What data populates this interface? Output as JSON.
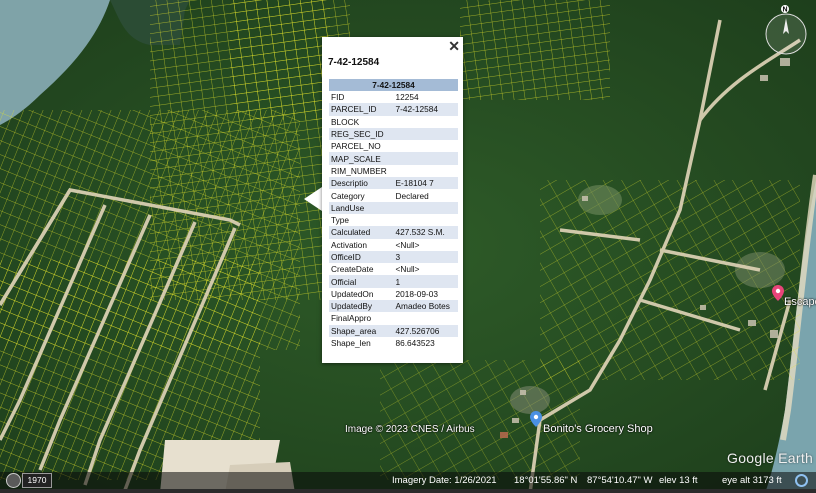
{
  "popup": {
    "title": "7-42-12584",
    "table_header": "7-42-12584",
    "rows": [
      {
        "key": "FID",
        "value": "12254"
      },
      {
        "key": "PARCEL_ID",
        "value": "7-42-12584"
      },
      {
        "key": "BLOCK",
        "value": ""
      },
      {
        "key": "REG_SEC_ID",
        "value": ""
      },
      {
        "key": "PARCEL_NO",
        "value": ""
      },
      {
        "key": "MAP_SCALE",
        "value": ""
      },
      {
        "key": "RIM_NUMBER",
        "value": ""
      },
      {
        "key": "Descriptio",
        "value": "E-18104 7"
      },
      {
        "key": "Category",
        "value": "Declared"
      },
      {
        "key": "LandUse",
        "value": ""
      },
      {
        "key": "Type",
        "value": ""
      },
      {
        "key": "Calculated",
        "value": "427.532 S.M."
      },
      {
        "key": "Activation",
        "value": "<Null>"
      },
      {
        "key": "OfficeID",
        "value": "3"
      },
      {
        "key": "CreateDate",
        "value": "<Null>"
      },
      {
        "key": "Official",
        "value": "1"
      },
      {
        "key": "UpdatedOn",
        "value": "2018-09-03"
      },
      {
        "key": "UpdatedBy",
        "value": "Amadeo Botes"
      },
      {
        "key": "FinalAppro",
        "value": ""
      },
      {
        "key": "Shape_area",
        "value": "427.526706"
      },
      {
        "key": "Shape_len",
        "value": "86.643523"
      }
    ]
  },
  "map": {
    "attribution": "Image © 2023 CNES / Airbus",
    "places": [
      {
        "name": "Bonito's Grocery Shop",
        "icon": "shop-pin-icon",
        "color": "#4a90e2"
      },
      {
        "name": "Escape",
        "icon": "hotel-pin-icon",
        "color": "#e8457a"
      }
    ],
    "compass_label": "N",
    "logo": "Google Earth"
  },
  "status": {
    "year": "1970",
    "imagery_date": "Imagery Date: 1/26/2021",
    "lat": "18°01'55.86\" N",
    "lon": "87°54'10.47\" W",
    "elev": "elev   13 ft",
    "eye_alt": "eye alt  3173 ft"
  },
  "colors": {
    "parcel_lines": "#e4e42a",
    "popup_header": "#a4bbd6",
    "popup_alt_row": "#dfe6f1",
    "road": "#d9cfb2",
    "water": "#7fa3a8"
  }
}
